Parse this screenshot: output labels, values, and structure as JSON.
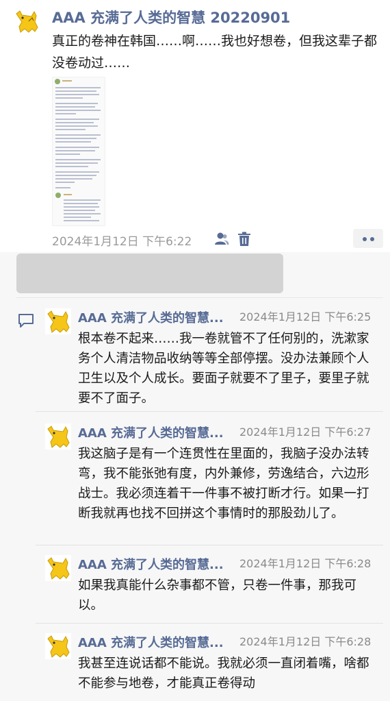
{
  "post": {
    "author": "AAA 充满了人类的智慧 20220901",
    "text": "真正的卷神在韩国……啊……我也好想卷，但我这辈子都没卷动过……",
    "time": "2024年1月12日 下午6:22"
  },
  "comments": [
    {
      "author": "AAA 充满了人类的智慧...",
      "time": "2024年1月12日 下午6:25",
      "text": "根本卷不起来……我一卷就管不了任何别的，洗漱家务个人清洁物品收纳等等全部停摆。没办法兼顾个人卫生以及个人成长。要面子就要不了里子，要里子就要不了面子。"
    },
    {
      "author": "AAA 充满了人类的智慧...",
      "time": "2024年1月12日 下午6:27",
      "text": "我这脑子是有一个连贯性在里面的，我脑子没办法转弯，我不能张弛有度，内外兼修，劳逸结合，六边形战士。我必须连着干一件事不被打断才行。如果一打断我就再也找不回拼这个事情时的那股劲儿了。"
    },
    {
      "author": "AAA 充满了人类的智慧...",
      "time": "2024年1月12日 下午6:28",
      "text": "如果我真能什么杂事都不管，只卷一件事，那我可以。"
    },
    {
      "author": "AAA 充满了人类的智慧...",
      "time": "2024年1月12日 下午6:28",
      "text": "我甚至连说话都不能说。我就必须一直闭着嘴，啥都不能参与地卷，才能真正卷得动"
    }
  ],
  "colors": {
    "name": "#576b95",
    "avatar_bg": "#f5c518",
    "feedback_bg": "#f7f7f7"
  }
}
